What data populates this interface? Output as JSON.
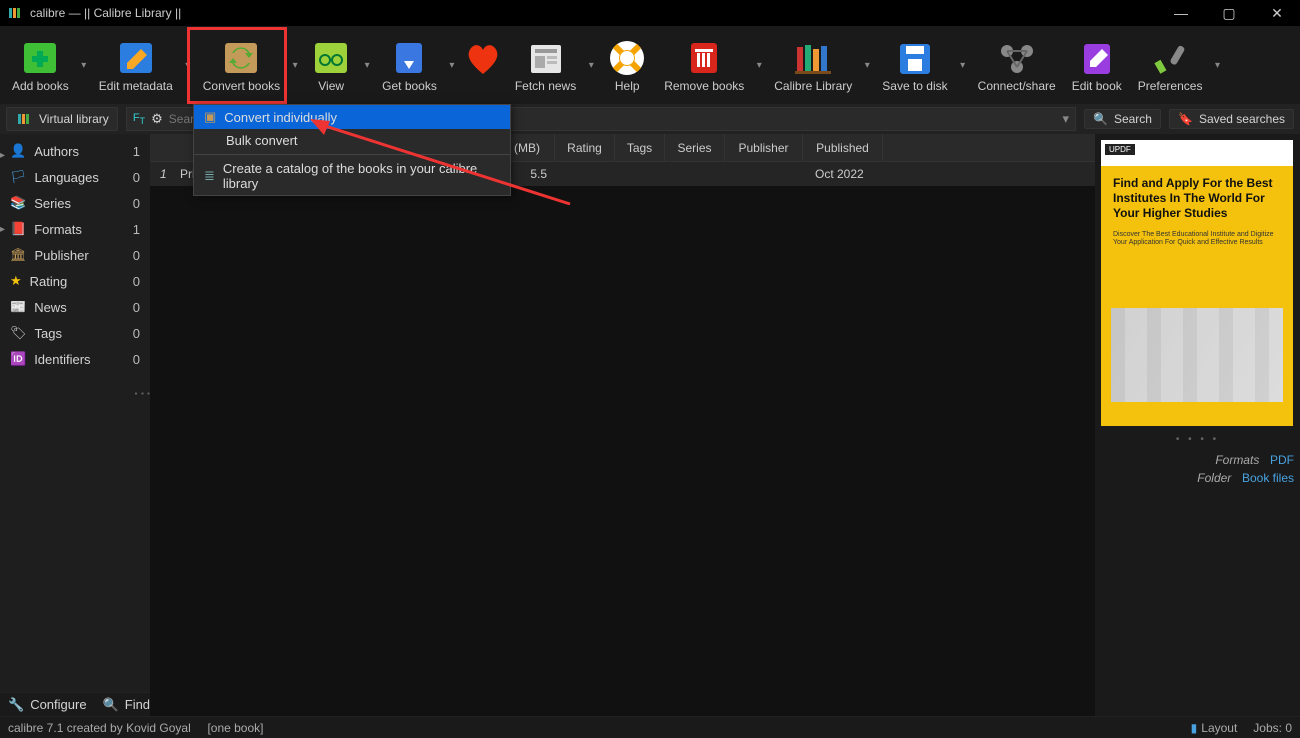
{
  "window": {
    "title": "calibre — || Calibre Library ||"
  },
  "toolbar": {
    "add_books": "Add books",
    "edit_metadata": "Edit metadata",
    "convert_books": "Convert books",
    "view": "View",
    "get_books": "Get books",
    "fetch_news": "Fetch news",
    "help": "Help",
    "remove_books": "Remove books",
    "calibre_library": "Calibre Library",
    "save_to_disk": "Save to disk",
    "connect_share": "Connect/share",
    "edit_book": "Edit book",
    "preferences": "Preferences"
  },
  "searchbar": {
    "virtual_library": "Virtual library",
    "search_placeholder": "Searc",
    "search_btn": "Search",
    "saved_searches": "Saved searches"
  },
  "sidebar": {
    "items": [
      {
        "label": "Authors",
        "count": "1"
      },
      {
        "label": "Languages",
        "count": "0"
      },
      {
        "label": "Series",
        "count": "0"
      },
      {
        "label": "Formats",
        "count": "1"
      },
      {
        "label": "Publisher",
        "count": "0"
      },
      {
        "label": "Rating",
        "count": "0"
      },
      {
        "label": "News",
        "count": "0"
      },
      {
        "label": "Tags",
        "count": "0"
      },
      {
        "label": "Identifiers",
        "count": "0"
      }
    ]
  },
  "table": {
    "headers": {
      "size": "(MB)",
      "rating": "Rating",
      "tags": "Tags",
      "series": "Series",
      "publisher": "Publisher",
      "published": "Published"
    },
    "row": {
      "num": "1",
      "title": "Print",
      "size": "5.5",
      "published": "Oct 2022"
    }
  },
  "dropdown": {
    "item1": "Convert individually",
    "item2": "Bulk convert",
    "item3": "Create a catalog of the books in your calibre library"
  },
  "book": {
    "cover_badge": "UPDF",
    "cover_title": "Find and Apply For the Best Institutes In The World For Your Higher Studies",
    "cover_sub": "Discover The Best Educational Institute and Digitize Your Application For Quick and Effective Results",
    "formats_label": "Formats",
    "formats_value": "PDF",
    "folder_label": "Folder",
    "folder_value": "Book files"
  },
  "footer": {
    "configure": "Configure",
    "find": "Find",
    "credits": "calibre 7.1 created by Kovid Goyal",
    "book_count": "[one book]",
    "layout": "Layout",
    "jobs": "Jobs: 0"
  }
}
